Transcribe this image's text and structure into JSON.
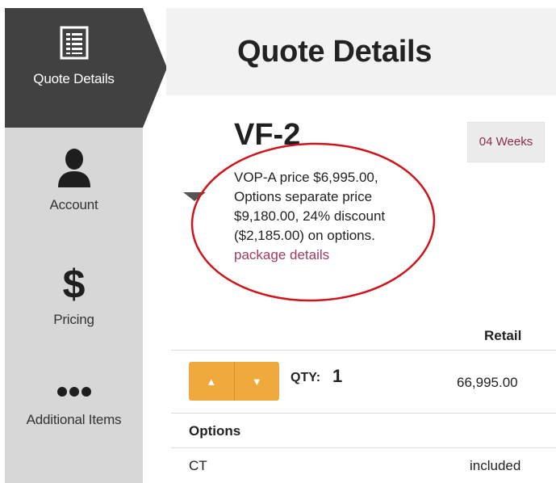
{
  "sidebar": {
    "items": [
      {
        "label": "Quote Details",
        "icon": "list-document-icon",
        "active": true
      },
      {
        "label": "Account",
        "icon": "person-icon"
      },
      {
        "label": "Pricing",
        "icon": "dollar-icon",
        "glyph": "$"
      },
      {
        "label": "Additional Items",
        "icon": "more-dots-icon"
      }
    ]
  },
  "header": {
    "title": "Quote Details"
  },
  "product": {
    "name": "VF-2",
    "lead_time": "04 Weeks",
    "description_lines": [
      "VOP-A price $6,995.00,",
      "Options separate price",
      "$9,180.00, 24% discount",
      "($2,185.00) on options."
    ],
    "package_link": "package details"
  },
  "table": {
    "retail_header": "Retail",
    "qty_label": "QTY:",
    "qty_value": "1",
    "price": "66,995.00",
    "up_glyph": "▲",
    "down_glyph": "▼",
    "options_header": "Options",
    "rows": [
      {
        "name": "CT",
        "value": "included"
      }
    ]
  },
  "colors": {
    "sidebar_active": "#414141",
    "sidebar_bg": "#d7d7d7",
    "header_bg": "#f2f2f2",
    "stepper": "#f0a93d",
    "link": "#a23a5a",
    "annotation_circle": "#d0141c"
  }
}
